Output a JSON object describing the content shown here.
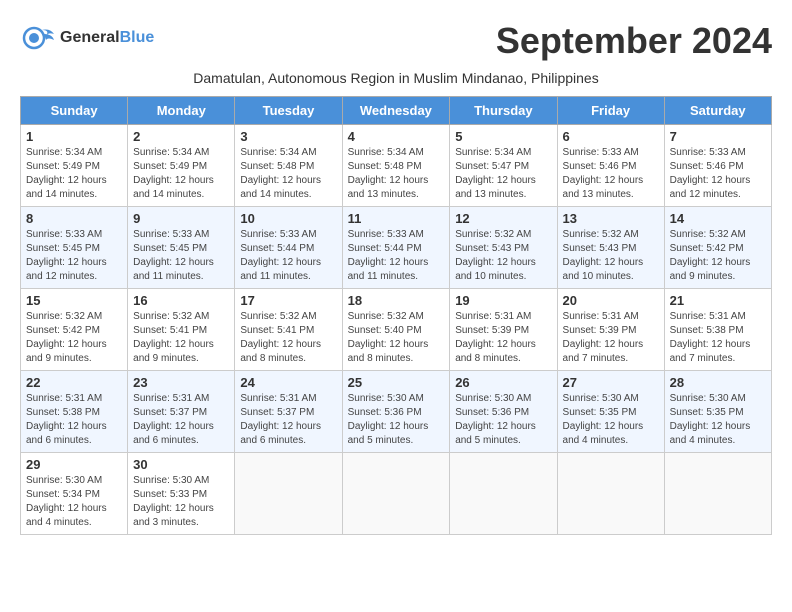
{
  "header": {
    "logo_general": "General",
    "logo_blue": "Blue",
    "month_title": "September 2024",
    "subtitle": "Damatulan, Autonomous Region in Muslim Mindanao, Philippines"
  },
  "weekdays": [
    "Sunday",
    "Monday",
    "Tuesday",
    "Wednesday",
    "Thursday",
    "Friday",
    "Saturday"
  ],
  "weeks": [
    [
      {
        "day": "1",
        "sunrise": "5:34 AM",
        "sunset": "5:49 PM",
        "daylight": "12 hours and 14 minutes."
      },
      {
        "day": "2",
        "sunrise": "5:34 AM",
        "sunset": "5:49 PM",
        "daylight": "12 hours and 14 minutes."
      },
      {
        "day": "3",
        "sunrise": "5:34 AM",
        "sunset": "5:48 PM",
        "daylight": "12 hours and 14 minutes."
      },
      {
        "day": "4",
        "sunrise": "5:34 AM",
        "sunset": "5:48 PM",
        "daylight": "12 hours and 13 minutes."
      },
      {
        "day": "5",
        "sunrise": "5:34 AM",
        "sunset": "5:47 PM",
        "daylight": "12 hours and 13 minutes."
      },
      {
        "day": "6",
        "sunrise": "5:33 AM",
        "sunset": "5:46 PM",
        "daylight": "12 hours and 13 minutes."
      },
      {
        "day": "7",
        "sunrise": "5:33 AM",
        "sunset": "5:46 PM",
        "daylight": "12 hours and 12 minutes."
      }
    ],
    [
      {
        "day": "8",
        "sunrise": "5:33 AM",
        "sunset": "5:45 PM",
        "daylight": "12 hours and 12 minutes."
      },
      {
        "day": "9",
        "sunrise": "5:33 AM",
        "sunset": "5:45 PM",
        "daylight": "12 hours and 11 minutes."
      },
      {
        "day": "10",
        "sunrise": "5:33 AM",
        "sunset": "5:44 PM",
        "daylight": "12 hours and 11 minutes."
      },
      {
        "day": "11",
        "sunrise": "5:33 AM",
        "sunset": "5:44 PM",
        "daylight": "12 hours and 11 minutes."
      },
      {
        "day": "12",
        "sunrise": "5:32 AM",
        "sunset": "5:43 PM",
        "daylight": "12 hours and 10 minutes."
      },
      {
        "day": "13",
        "sunrise": "5:32 AM",
        "sunset": "5:43 PM",
        "daylight": "12 hours and 10 minutes."
      },
      {
        "day": "14",
        "sunrise": "5:32 AM",
        "sunset": "5:42 PM",
        "daylight": "12 hours and 9 minutes."
      }
    ],
    [
      {
        "day": "15",
        "sunrise": "5:32 AM",
        "sunset": "5:42 PM",
        "daylight": "12 hours and 9 minutes."
      },
      {
        "day": "16",
        "sunrise": "5:32 AM",
        "sunset": "5:41 PM",
        "daylight": "12 hours and 9 minutes."
      },
      {
        "day": "17",
        "sunrise": "5:32 AM",
        "sunset": "5:41 PM",
        "daylight": "12 hours and 8 minutes."
      },
      {
        "day": "18",
        "sunrise": "5:32 AM",
        "sunset": "5:40 PM",
        "daylight": "12 hours and 8 minutes."
      },
      {
        "day": "19",
        "sunrise": "5:31 AM",
        "sunset": "5:39 PM",
        "daylight": "12 hours and 8 minutes."
      },
      {
        "day": "20",
        "sunrise": "5:31 AM",
        "sunset": "5:39 PM",
        "daylight": "12 hours and 7 minutes."
      },
      {
        "day": "21",
        "sunrise": "5:31 AM",
        "sunset": "5:38 PM",
        "daylight": "12 hours and 7 minutes."
      }
    ],
    [
      {
        "day": "22",
        "sunrise": "5:31 AM",
        "sunset": "5:38 PM",
        "daylight": "12 hours and 6 minutes."
      },
      {
        "day": "23",
        "sunrise": "5:31 AM",
        "sunset": "5:37 PM",
        "daylight": "12 hours and 6 minutes."
      },
      {
        "day": "24",
        "sunrise": "5:31 AM",
        "sunset": "5:37 PM",
        "daylight": "12 hours and 6 minutes."
      },
      {
        "day": "25",
        "sunrise": "5:30 AM",
        "sunset": "5:36 PM",
        "daylight": "12 hours and 5 minutes."
      },
      {
        "day": "26",
        "sunrise": "5:30 AM",
        "sunset": "5:36 PM",
        "daylight": "12 hours and 5 minutes."
      },
      {
        "day": "27",
        "sunrise": "5:30 AM",
        "sunset": "5:35 PM",
        "daylight": "12 hours and 4 minutes."
      },
      {
        "day": "28",
        "sunrise": "5:30 AM",
        "sunset": "5:35 PM",
        "daylight": "12 hours and 4 minutes."
      }
    ],
    [
      {
        "day": "29",
        "sunrise": "5:30 AM",
        "sunset": "5:34 PM",
        "daylight": "12 hours and 4 minutes."
      },
      {
        "day": "30",
        "sunrise": "5:30 AM",
        "sunset": "5:33 PM",
        "daylight": "12 hours and 3 minutes."
      },
      null,
      null,
      null,
      null,
      null
    ]
  ]
}
